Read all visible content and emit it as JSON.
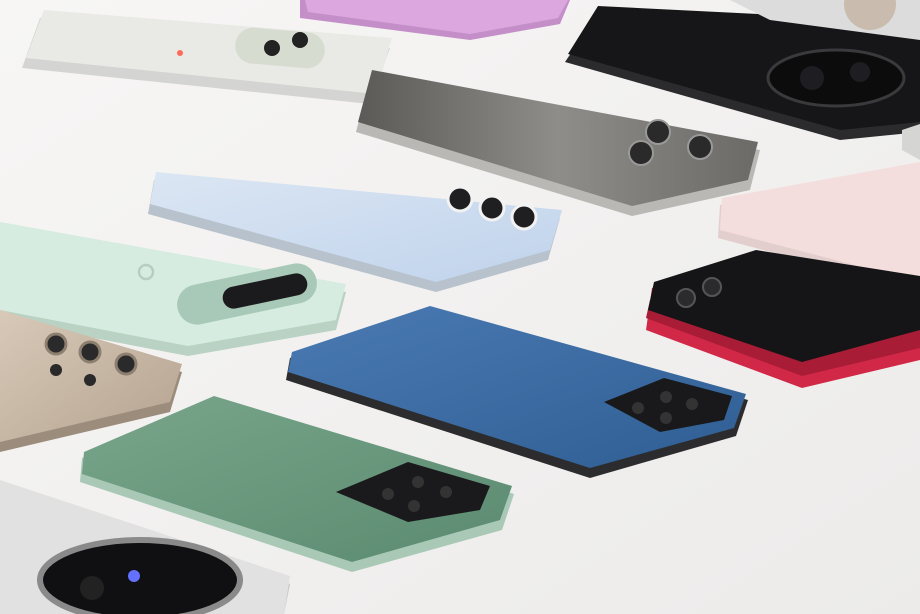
{
  "scene": {
    "description_free": true,
    "background": "#f2f1f0",
    "phones": [
      {
        "name": "phone-white-glass",
        "color": "#e6e7e3",
        "camera": "pill"
      },
      {
        "name": "phone-pink",
        "color": "#d9a6dc",
        "camera": "none"
      },
      {
        "name": "phone-black-rear",
        "color": "#1c1c1e",
        "camera": "round-large"
      },
      {
        "name": "phone-gray-metal",
        "color": "#7d7b78",
        "camera": "triple-square"
      },
      {
        "name": "phone-light-blue",
        "color": "#c7d7ec",
        "camera": "triple-vertical"
      },
      {
        "name": "phone-mint",
        "color": "#cfe8d9",
        "camera": "bar"
      },
      {
        "name": "phone-light-pink",
        "color": "#f1dada",
        "camera": "none"
      },
      {
        "name": "phone-red-flip",
        "color": "#e0314f",
        "camera": "dual"
      },
      {
        "name": "phone-titanium",
        "color": "#c7b7a5",
        "camera": "quad"
      },
      {
        "name": "phone-blue",
        "color": "#3f6fa4",
        "camera": "square-block"
      },
      {
        "name": "phone-green",
        "color": "#6c9a80",
        "camera": "square-block"
      },
      {
        "name": "phone-silver-bottom",
        "color": "#d9dad9",
        "camera": "round-large"
      }
    ]
  }
}
